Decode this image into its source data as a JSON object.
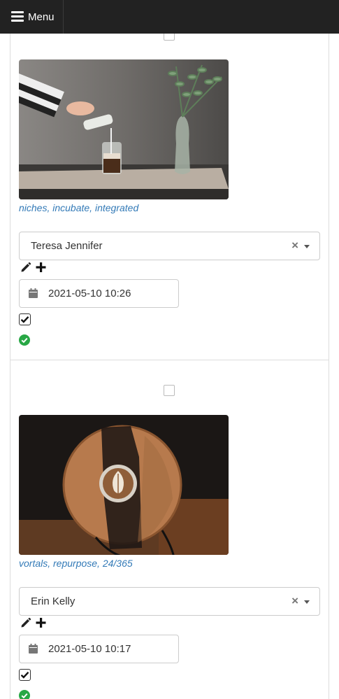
{
  "topbar": {
    "menu_label": "Menu"
  },
  "cards": [
    {
      "tags": "niches, incubate, integrated",
      "assignee": "Teresa Jennifer",
      "clear_symbol": "×",
      "datetime": "2021-05-10 10:26",
      "checked": true,
      "status": "ok"
    },
    {
      "tags": "vortals, repurpose, 24/365",
      "assignee": "Erin Kelly",
      "clear_symbol": "×",
      "datetime": "2021-05-10 10:17",
      "checked": true,
      "status": "ok"
    }
  ],
  "colors": {
    "topbar": "#222222",
    "link": "#337ab7",
    "success": "#28a745"
  },
  "icons": [
    "hamburger-icon",
    "pencil-icon",
    "plus-icon",
    "calendar-icon",
    "check-circle-icon"
  ]
}
